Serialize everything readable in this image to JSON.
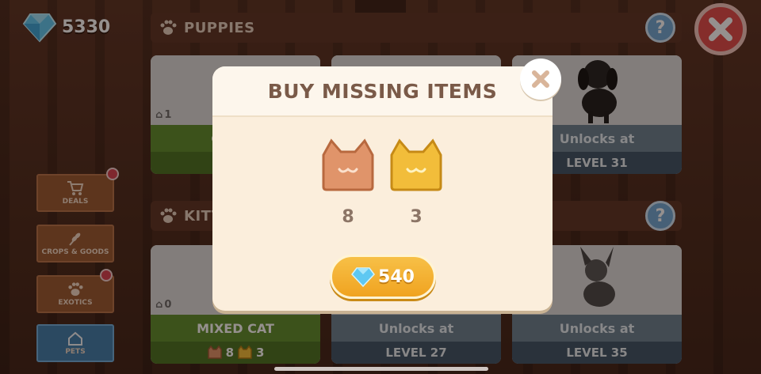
{
  "header": {
    "gem_count": "5330",
    "help_label": "?"
  },
  "sections": {
    "puppies": "PUPPIES",
    "kittens_partial": "KITT"
  },
  "menu": [
    {
      "label": "DEALS"
    },
    {
      "label": "CROPS & GOODS"
    },
    {
      "label": "EXOTICS"
    },
    {
      "label": "PETS"
    }
  ],
  "cards": {
    "golden": {
      "owned": "1",
      "name": "GOLDE"
    },
    "black_puppy": {
      "line1": "Unlocks at",
      "line2": "LEVEL 31"
    },
    "mixed_cat": {
      "owned": "0",
      "name": "MIXED CAT",
      "cost_a": "8",
      "cost_b": "3"
    },
    "locked_27": {
      "line1": "Unlocks at",
      "line2": "LEVEL 27"
    },
    "locked_35": {
      "line1": "Unlocks at",
      "line2": "LEVEL 35"
    }
  },
  "modal": {
    "title": "BUY MISSING ITEMS",
    "items": [
      {
        "token": "bronze-cat-token",
        "qty": "8",
        "color": "#e0946a"
      },
      {
        "token": "gold-cat-token",
        "qty": "3",
        "color": "#f2bd3a"
      }
    ],
    "price": "540"
  },
  "colors": {
    "gem": "#5ec8f2",
    "close_red": "#e24b4b",
    "buy_orange": "#f0a320",
    "card_green": "#5e8f2f",
    "card_locked": "#3c5468"
  }
}
